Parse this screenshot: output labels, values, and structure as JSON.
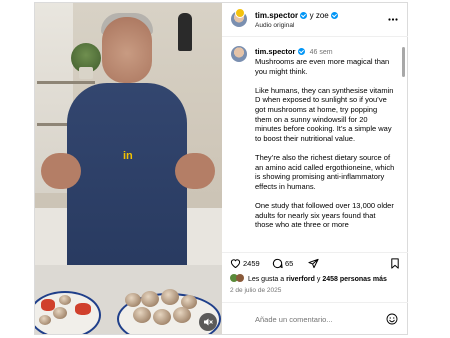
{
  "header": {
    "username": "tim.spector",
    "coauthor": "y zoe",
    "audio_label": "Audio original",
    "more_icon": "more-horizontal-icon"
  },
  "caption": {
    "username": "tim.spector",
    "time": "46 sem",
    "paragraphs": [
      "Mushrooms are even more magical than you might think.",
      "Like humans, they can synthesise vitamin D when exposed to sunlight so if you’ve got mushrooms at home, try popping them on a sunny windowsill for 20 minutes before cooking. It’s a simple way to boost their nutritional value.",
      "They’re also the richest dietary source of an amino acid called ergothioneine, which is showing promising anti-inflammatory effects in humans.",
      "One study that followed over 13,000 older adults for nearly six years found that those who ate three or more"
    ]
  },
  "media": {
    "overlay_text": "in"
  },
  "actions": {
    "like_count": "2459",
    "comment_count": "65",
    "like_icon": "heart-icon",
    "comment_icon": "comment-bubble-icon",
    "share_icon": "send-icon",
    "save_icon": "bookmark-icon"
  },
  "likes": {
    "prefix": "Les gusta a",
    "user": "riverford",
    "connector": "y",
    "others": "2458 personas",
    "suffix": "más"
  },
  "date": "2 de julio de 2025",
  "comment": {
    "placeholder": "Añade un comentario..."
  },
  "colors": {
    "verified": "#0095f6",
    "secondary_text": "#737373",
    "divider": "#efefef"
  }
}
